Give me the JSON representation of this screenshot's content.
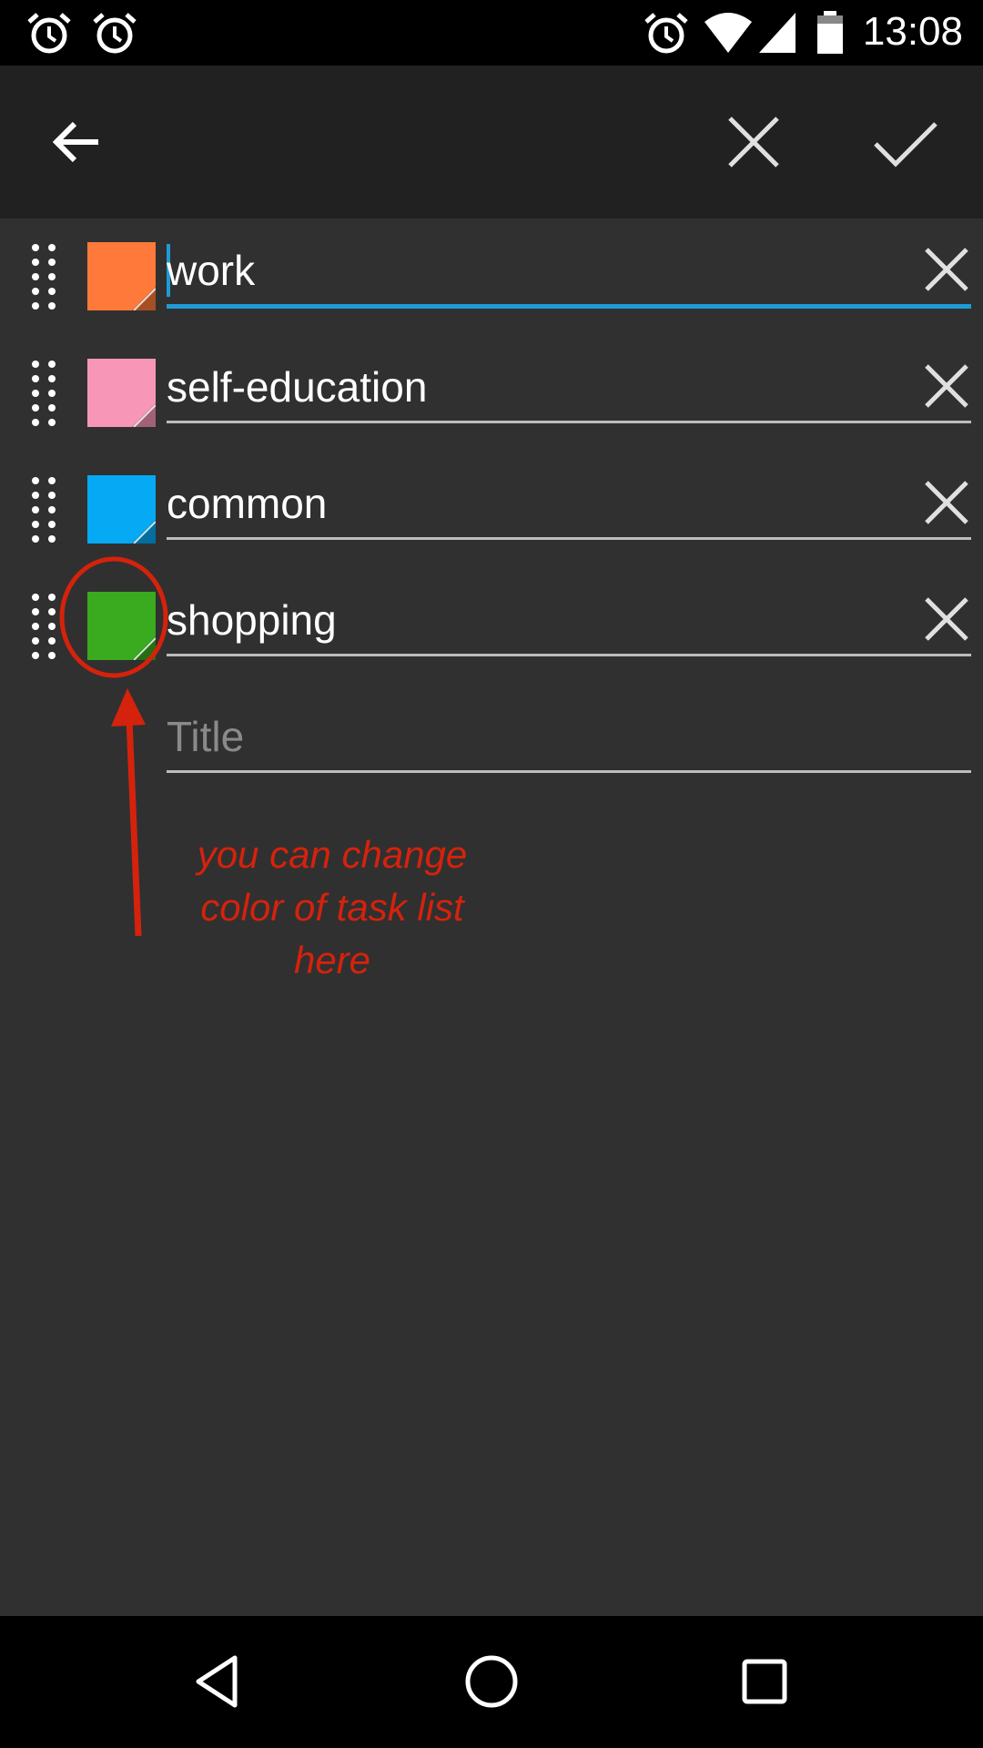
{
  "status_bar": {
    "time": "13:08",
    "icons": [
      "alarm-icon",
      "alarm-icon",
      "alarm-icon",
      "wifi-icon",
      "signal-icon",
      "battery-icon"
    ]
  },
  "toolbar": {
    "back_icon": "arrow-left-icon",
    "cancel_icon": "close-icon",
    "confirm_icon": "check-icon"
  },
  "lists": [
    {
      "title": "work",
      "color": "#ff7a3a",
      "active": true
    },
    {
      "title": "self-education",
      "color": "#f796b6",
      "active": false
    },
    {
      "title": "common",
      "color": "#05a9f4",
      "active": false
    },
    {
      "title": "shopping",
      "color": "#3aaa1f",
      "active": false
    }
  ],
  "new_item": {
    "placeholder": "Title"
  },
  "annotation": {
    "lines": [
      "you can change",
      "color of task list",
      "here"
    ],
    "color": "#d5220c"
  },
  "nav_bar": {
    "icons": [
      "back-triangle-icon",
      "home-circle-icon",
      "recents-square-icon"
    ]
  }
}
